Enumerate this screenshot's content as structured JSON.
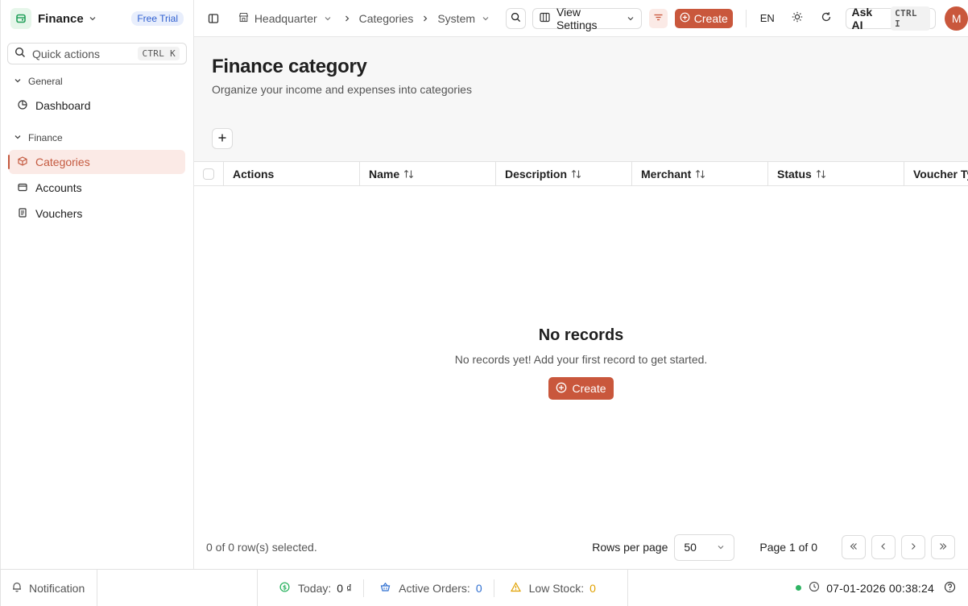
{
  "brand": {
    "name": "Finance",
    "badge": "Free Trial"
  },
  "quick_actions": {
    "label": "Quick actions",
    "shortcut": "CTRL K"
  },
  "sidebar": {
    "groups": [
      {
        "label": "General",
        "items": [
          {
            "label": "Dashboard",
            "icon": "pie-chart-icon"
          }
        ]
      },
      {
        "label": "Finance",
        "items": [
          {
            "label": "Categories",
            "icon": "box-icon",
            "active": true
          },
          {
            "label": "Accounts",
            "icon": "wallet-icon"
          },
          {
            "label": "Vouchers",
            "icon": "receipt-icon"
          }
        ]
      }
    ]
  },
  "topbar": {
    "breadcrumb": [
      "Headquarter",
      "Categories",
      "System"
    ],
    "view_settings": "View Settings",
    "create": "Create",
    "lang": "EN",
    "ask_ai": "Ask AI",
    "ask_ai_shortcut": "CTRL I",
    "avatar_initial": "M"
  },
  "page": {
    "title": "Finance category",
    "subtitle": "Organize your income and expenses into categories"
  },
  "table": {
    "columns": [
      "Actions",
      "Name",
      "Description",
      "Merchant",
      "Status",
      "Voucher Type"
    ],
    "empty_title": "No records",
    "empty_sub": "No records yet! Add your first record to get started.",
    "empty_create": "Create"
  },
  "footer": {
    "selected": "0 of 0 row(s) selected.",
    "rows_label": "Rows per page",
    "rows_value": "50",
    "page_info": "Page 1 of 0"
  },
  "statusbar": {
    "notification": "Notification",
    "today_label": "Today:",
    "today_value": "0 ₫",
    "orders_label": "Active Orders:",
    "orders_value": "0",
    "stock_label": "Low Stock:",
    "stock_value": "0",
    "datetime": "07-01-2026 00:38:24"
  },
  "colors": {
    "accent": "#c9573c",
    "accent_soft": "#fbeae6",
    "online": "#2fb463",
    "link_blue": "#2f6fd0",
    "warning": "#e0a100"
  }
}
